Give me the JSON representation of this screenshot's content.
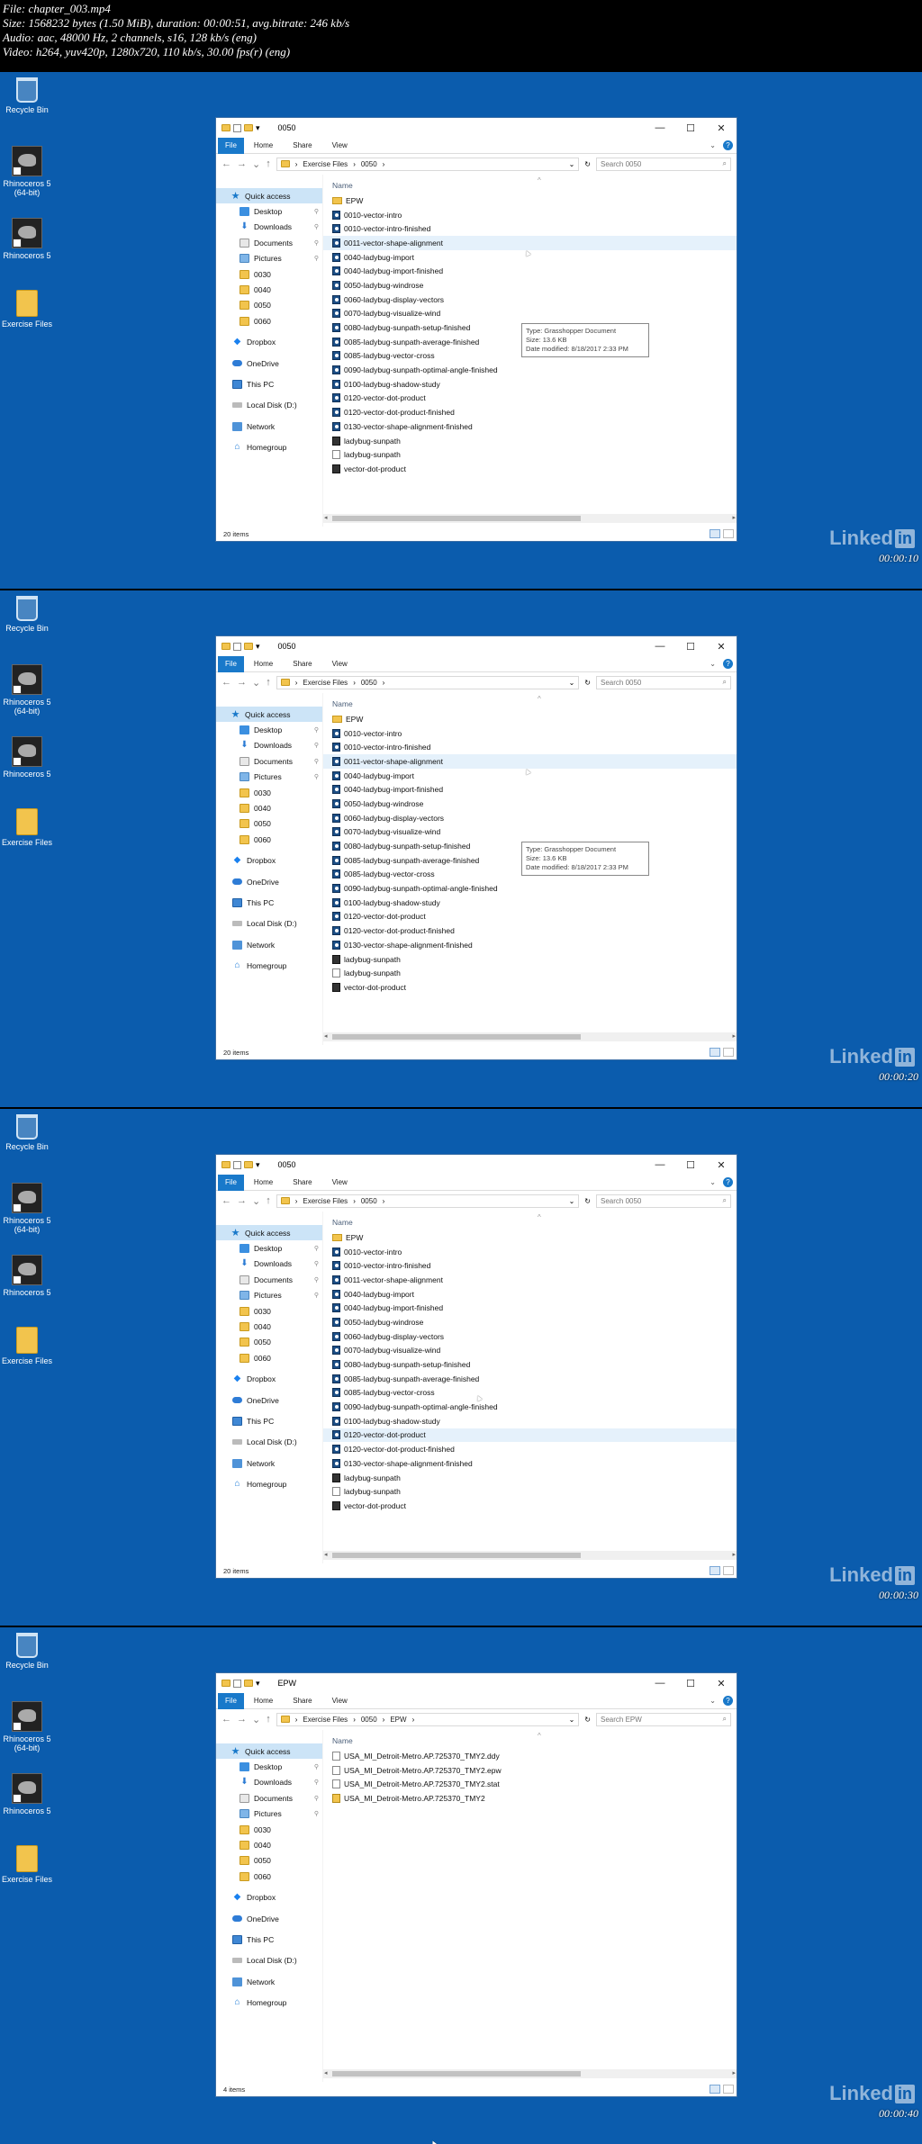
{
  "header": {
    "lines": [
      "File: chapter_003.mp4",
      "Size: 1568232 bytes (1.50 MiB), duration: 00:00:51, avg.bitrate: 246 kb/s",
      "Audio: aac, 48000 Hz, 2 channels, s16, 128 kb/s (eng)",
      "Video: h264, yuv420p, 1280x720, 110 kb/s, 30.00 fps(r) (eng)"
    ]
  },
  "desktop_icons": [
    {
      "label": "Recycle Bin",
      "icon": "recycle-bin-icon"
    },
    {
      "label": "Rhinoceros 5 (64-bit)",
      "icon": "rhinoceros-icon"
    },
    {
      "label": "Rhinoceros 5",
      "icon": "rhinoceros-icon"
    },
    {
      "label": "Exercise Files",
      "icon": "folder-icon"
    }
  ],
  "explorer": {
    "ribbon": {
      "file": "File",
      "home": "Home",
      "share": "Share",
      "view": "View"
    },
    "column_name": "Name",
    "window_controls": {
      "minimize": "—",
      "maximize": "☐",
      "close": "✕"
    },
    "nav_items": [
      {
        "label": "Quick access",
        "icon": "star-icon",
        "cls": "qa",
        "pin": false
      },
      {
        "label": "Desktop",
        "icon": "desk",
        "cls": "sub",
        "pin": true
      },
      {
        "label": "Downloads",
        "icon": "down",
        "cls": "sub",
        "pin": true
      },
      {
        "label": "Documents",
        "icon": "doc",
        "cls": "sub",
        "pin": true
      },
      {
        "label": "Pictures",
        "icon": "pics",
        "cls": "sub",
        "pin": true
      },
      {
        "label": "0030",
        "icon": "fold",
        "cls": "sub",
        "pin": false
      },
      {
        "label": "0040",
        "icon": "fold",
        "cls": "sub",
        "pin": false
      },
      {
        "label": "0050",
        "icon": "fold",
        "cls": "sub",
        "pin": false
      },
      {
        "label": "0060",
        "icon": "fold",
        "cls": "sub",
        "pin": false
      },
      {
        "label": "Dropbox",
        "icon": "drop",
        "cls": "gap",
        "pin": false
      },
      {
        "label": "OneDrive",
        "icon": "cloud",
        "cls": "gap",
        "pin": false
      },
      {
        "label": "This PC",
        "icon": "pc",
        "cls": "gap",
        "pin": false
      },
      {
        "label": "Local Disk (D:)",
        "icon": "disk",
        "cls": "gap",
        "pin": false
      },
      {
        "label": "Network",
        "icon": "net",
        "cls": "gap",
        "pin": false
      },
      {
        "label": "Homegroup",
        "icon": "home",
        "cls": "gap",
        "pin": false
      }
    ]
  },
  "files_0050": [
    {
      "name": "EPW",
      "type": "folder"
    },
    {
      "name": "0010-vector-intro",
      "type": "gh"
    },
    {
      "name": "0010-vector-intro-finished",
      "type": "gh"
    },
    {
      "name": "0011-vector-shape-alignment",
      "type": "gh"
    },
    {
      "name": "0040-ladybug-import",
      "type": "gh"
    },
    {
      "name": "0040-ladybug-import-finished",
      "type": "gh"
    },
    {
      "name": "0050-ladybug-windrose",
      "type": "gh"
    },
    {
      "name": "0060-ladybug-display-vectors",
      "type": "gh"
    },
    {
      "name": "0070-ladybug-visualize-wind",
      "type": "gh"
    },
    {
      "name": "0080-ladybug-sunpath-setup-finished",
      "type": "gh"
    },
    {
      "name": "0085-ladybug-sunpath-average-finished",
      "type": "gh"
    },
    {
      "name": "0085-ladybug-vector-cross",
      "type": "gh"
    },
    {
      "name": "0090-ladybug-sunpath-optimal-angle-finished",
      "type": "gh"
    },
    {
      "name": "0100-ladybug-shadow-study",
      "type": "gh"
    },
    {
      "name": "0120-vector-dot-product",
      "type": "gh"
    },
    {
      "name": "0120-vector-dot-product-finished",
      "type": "gh"
    },
    {
      "name": "0130-vector-shape-alignment-finished",
      "type": "gh"
    },
    {
      "name": "ladybug-sunpath",
      "type": "rhino"
    },
    {
      "name": "ladybug-sunpath",
      "type": "doc"
    },
    {
      "name": "vector-dot-product",
      "type": "rhino"
    }
  ],
  "files_epw": [
    {
      "name": "USA_MI_Detroit-Metro.AP.725370_TMY2.ddy",
      "type": "doc"
    },
    {
      "name": "USA_MI_Detroit-Metro.AP.725370_TMY2.epw",
      "type": "doc"
    },
    {
      "name": "USA_MI_Detroit-Metro.AP.725370_TMY2.stat",
      "type": "doc"
    },
    {
      "name": "USA_MI_Detroit-Metro.AP.725370_TMY2",
      "type": "zip"
    }
  ],
  "tooltip": {
    "type": "Type: Grasshopper Document",
    "size": "Size: 13.6 KB",
    "date": "Date modified: 8/18/2017 2:33 PM"
  },
  "frames": [
    {
      "title": "0050",
      "crumbs": [
        "Exercise Files",
        "0050"
      ],
      "search": "Search 0050",
      "files": "files_0050",
      "highlight": 3,
      "tooltip": true,
      "status": "20 items",
      "timestamp": "00:00:10"
    },
    {
      "title": "0050",
      "crumbs": [
        "Exercise Files",
        "0050"
      ],
      "search": "Search 0050",
      "files": "files_0050",
      "highlight": 3,
      "tooltip": true,
      "status": "20 items",
      "timestamp": "00:00:20"
    },
    {
      "title": "0050",
      "crumbs": [
        "Exercise Files",
        "0050"
      ],
      "search": "Search 0050",
      "files": "files_0050",
      "highlight": 14,
      "tooltip": false,
      "status": "20 items",
      "timestamp": "00:00:30"
    },
    {
      "title": "EPW",
      "crumbs": [
        "Exercise Files",
        "0050",
        "EPW"
      ],
      "search": "Search EPW",
      "files": "files_epw",
      "highlight": -1,
      "tooltip": false,
      "status": "4 items",
      "timestamp": "00:00:40"
    }
  ],
  "watermark": {
    "text": "Linked",
    "badge": "in"
  }
}
